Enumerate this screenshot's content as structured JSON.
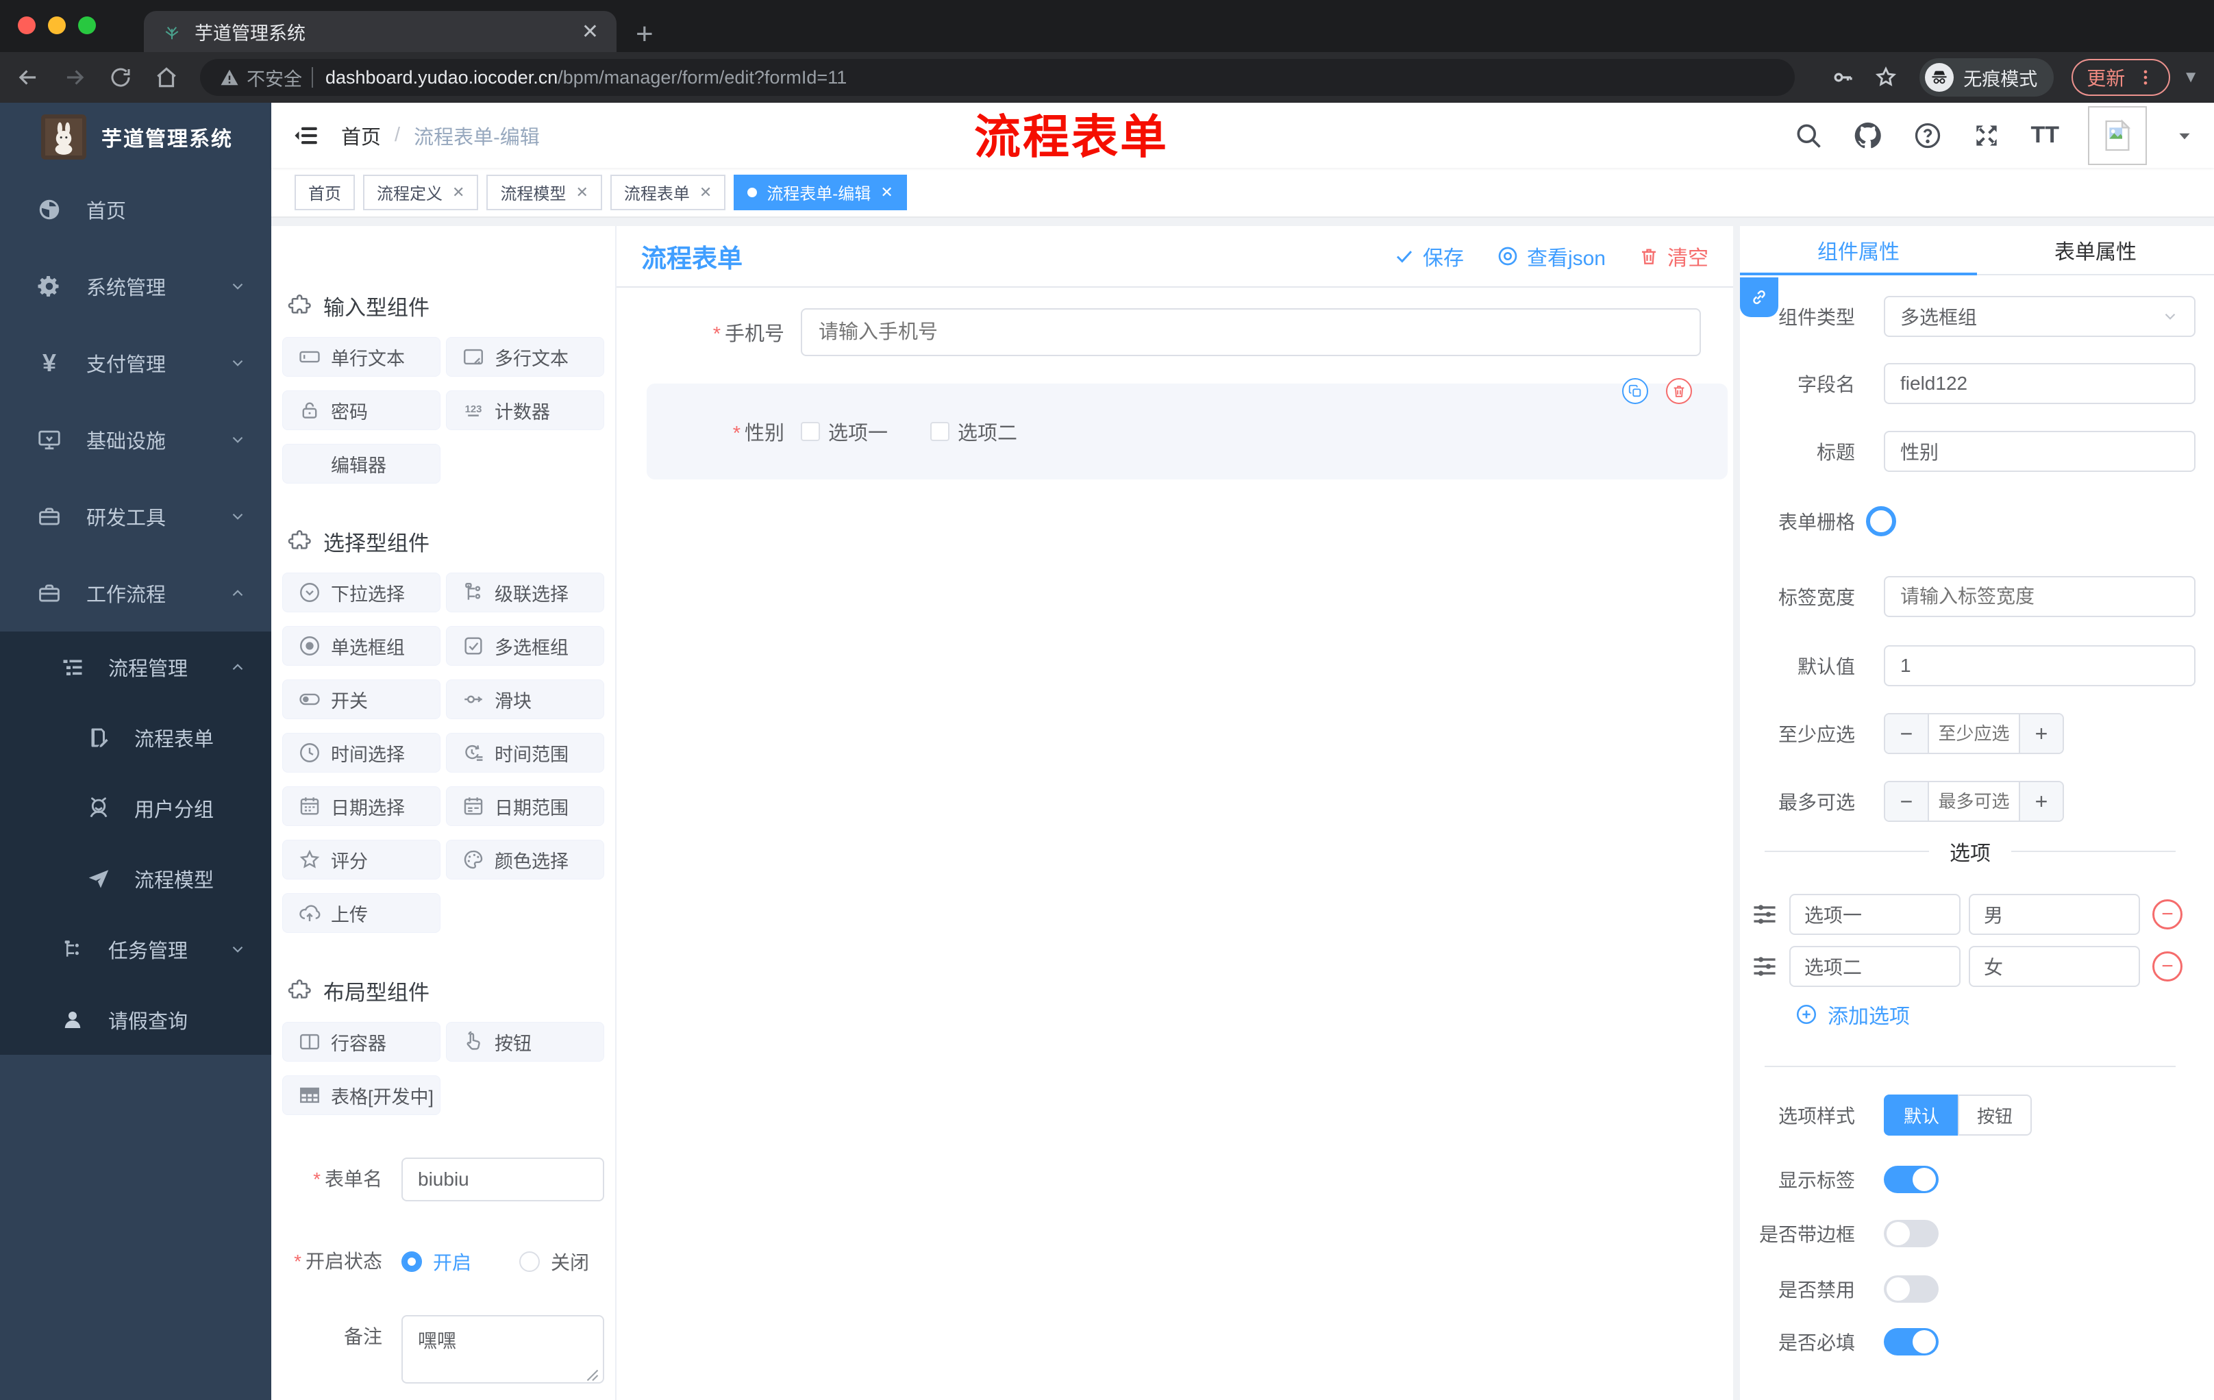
{
  "colors": {
    "accent": "#409eff",
    "danger": "#f56c6c",
    "annotation": "#f50e00",
    "sidebar_bg": "#304156",
    "submenu_bg": "#1f2d3d"
  },
  "browser": {
    "tab_title": "芋道管理系统",
    "security": "不安全",
    "domain": "dashboard.yudao.iocoder.cn",
    "path": "/bpm/manager/form/edit?formId=11",
    "incognito": "无痕模式",
    "update": "更新",
    "icons": [
      "back-icon",
      "forward-icon",
      "reload-icon",
      "home-icon",
      "key-icon",
      "star-icon",
      "incognito-icon",
      "more-vert-icon",
      "caret-down-icon"
    ]
  },
  "sidebar": {
    "logo": "芋道管理系统",
    "top_items": [
      {
        "label": "首页",
        "icon": "dashboard-icon"
      },
      {
        "label": "系统管理",
        "icon": "gear-icon",
        "chevron": "down"
      },
      {
        "label": "支付管理",
        "icon": "yen-icon",
        "chevron": "down"
      },
      {
        "label": "基础设施",
        "icon": "monitor-icon",
        "chevron": "down"
      },
      {
        "label": "研发工具",
        "icon": "briefcase-icon",
        "chevron": "down"
      },
      {
        "label": "工作流程",
        "icon": "briefcase-icon",
        "chevron": "up"
      }
    ],
    "sub": {
      "group": {
        "label": "流程管理",
        "icon": "list-tree-icon",
        "chevron": "up"
      },
      "children": [
        {
          "label": "流程表单",
          "icon": "document-edit-icon"
        },
        {
          "label": "用户分组",
          "icon": "users-icon"
        },
        {
          "label": "流程模型",
          "icon": "paper-plane-icon"
        }
      ],
      "task": {
        "label": "任务管理",
        "icon": "tree-icon",
        "chevron": "down"
      },
      "leave": {
        "label": "请假查询",
        "icon": "user-icon"
      }
    }
  },
  "header": {
    "breadcrumb_home": "首页",
    "breadcrumb_sep": "/",
    "breadcrumb_current": "流程表单-编辑",
    "annotation": "流程表单",
    "icons": [
      "search-icon",
      "github-icon",
      "help-icon",
      "fullscreen-icon",
      "font-size-icon",
      "avatar",
      "caret-down-icon"
    ]
  },
  "tags": {
    "items": [
      {
        "label": "首页",
        "closable": false,
        "active": false
      },
      {
        "label": "流程定义",
        "closable": true,
        "active": false
      },
      {
        "label": "流程模型",
        "closable": true,
        "active": false
      },
      {
        "label": "流程表单",
        "closable": true,
        "active": false
      },
      {
        "label": "流程表单-编辑",
        "closable": true,
        "active": true
      }
    ]
  },
  "palette": {
    "sections": [
      {
        "title": "输入型组件",
        "icon": "puzzle-icon",
        "items": [
          {
            "label": "单行文本",
            "icon": "input-icon"
          },
          {
            "label": "多行文本",
            "icon": "textarea-icon"
          },
          {
            "label": "密码",
            "icon": "lock-icon"
          },
          {
            "label": "计数器",
            "icon": "counter-icon"
          },
          {
            "label": "编辑器",
            "icon": ""
          }
        ]
      },
      {
        "title": "选择型组件",
        "icon": "puzzle-icon",
        "items": [
          {
            "label": "下拉选择",
            "icon": "select-icon"
          },
          {
            "label": "级联选择",
            "icon": "cascader-icon"
          },
          {
            "label": "单选框组",
            "icon": "radio-icon"
          },
          {
            "label": "多选框组",
            "icon": "checkbox-icon"
          },
          {
            "label": "开关",
            "icon": "switch-icon"
          },
          {
            "label": "滑块",
            "icon": "slider-icon"
          },
          {
            "label": "时间选择",
            "icon": "time-icon"
          },
          {
            "label": "时间范围",
            "icon": "time-range-icon"
          },
          {
            "label": "日期选择",
            "icon": "date-icon"
          },
          {
            "label": "日期范围",
            "icon": "date-range-icon"
          },
          {
            "label": "评分",
            "icon": "star-icon"
          },
          {
            "label": "颜色选择",
            "icon": "palette-icon"
          },
          {
            "label": "上传",
            "icon": "upload-icon"
          }
        ]
      },
      {
        "title": "布局型组件",
        "icon": "puzzle-icon",
        "items": [
          {
            "label": "行容器",
            "icon": "columns-icon"
          },
          {
            "label": "按钮",
            "icon": "pointer-icon"
          },
          {
            "label": "表格[开发中]",
            "icon": "table-icon"
          }
        ]
      }
    ]
  },
  "left_form": {
    "name_label": "表单名",
    "name_value": "biubiu",
    "status_label": "开启状态",
    "status_on": "开启",
    "status_off": "关闭",
    "remark_label": "备注",
    "remark_value": "嘿嘿"
  },
  "canvas": {
    "title": "流程表单",
    "save": "保存",
    "view_json": "查看json",
    "clear": "清空",
    "phone_label": "手机号",
    "phone_placeholder": "请输入手机号",
    "gender_label": "性别",
    "gender_opt1": "选项一",
    "gender_opt2": "选项二"
  },
  "props": {
    "tab_component": "组件属性",
    "tab_form": "表单属性",
    "type_label": "组件类型",
    "type_value": "多选框组",
    "field_label": "字段名",
    "field_value": "field122",
    "title_label": "标题",
    "title_value": "性别",
    "grid_label": "表单栅格",
    "label_width_label": "标签宽度",
    "label_width_placeholder": "请输入标签宽度",
    "default_label": "默认值",
    "default_value": "1",
    "min_label": "至少应选",
    "min_placeholder": "至少应选",
    "max_label": "最多可选",
    "max_placeholder": "最多可选",
    "options_divider": "选项",
    "options": [
      {
        "label": "选项一",
        "value": "男"
      },
      {
        "label": "选项二",
        "value": "女"
      }
    ],
    "add_option": "添加选项",
    "style_label": "选项样式",
    "style_default": "默认",
    "style_button": "按钮",
    "show_label": "显示标签",
    "border_label": "是否带边框",
    "disabled_label": "是否禁用",
    "required_label": "是否必填"
  }
}
